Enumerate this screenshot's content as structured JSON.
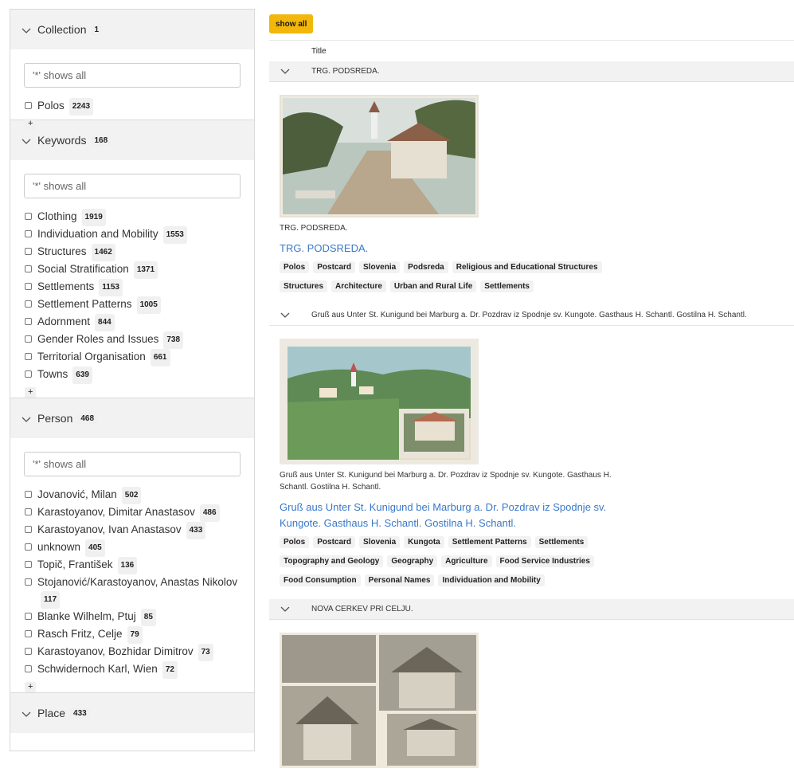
{
  "sidebar": {
    "facets": [
      {
        "title": "Collection",
        "count": "1",
        "placeholder": "'*' shows all",
        "options": [
          {
            "label": "Polos",
            "count": "2243"
          }
        ],
        "more": "+"
      },
      {
        "title": "Keywords",
        "count": "168",
        "placeholder": "'*' shows all",
        "options": [
          {
            "label": "Clothing",
            "count": "1919"
          },
          {
            "label": "Individuation and Mobility",
            "count": "1553"
          },
          {
            "label": "Structures",
            "count": "1462"
          },
          {
            "label": "Social Stratification",
            "count": "1371"
          },
          {
            "label": "Settlements",
            "count": "1153"
          },
          {
            "label": "Settlement Patterns",
            "count": "1005"
          },
          {
            "label": "Adornment",
            "count": "844"
          },
          {
            "label": "Gender Roles and Issues",
            "count": "738"
          },
          {
            "label": "Territorial Organisation",
            "count": "661"
          },
          {
            "label": "Towns",
            "count": "639"
          }
        ],
        "more": "+"
      },
      {
        "title": "Person",
        "count": "468",
        "placeholder": "'*' shows all",
        "options": [
          {
            "label": "Jovanović, Milan",
            "count": "502"
          },
          {
            "label": "Karastoyanov, Dimitar Anastasov",
            "count": "486"
          },
          {
            "label": "Karastoyanov, Ivan Anastasov",
            "count": "433"
          },
          {
            "label": "unknown",
            "count": "405"
          },
          {
            "label": "Topič, František",
            "count": "136"
          },
          {
            "label": "Stojanović/Karastoyanov, Anastas Nikolov",
            "count": "117"
          },
          {
            "label": "Blanke Wilhelm, Ptuj",
            "count": "85"
          },
          {
            "label": "Rasch Fritz, Celje",
            "count": "79"
          },
          {
            "label": "Karastoyanov, Bozhidar Dimitrov",
            "count": "73"
          },
          {
            "label": "Schwidernoch Karl, Wien",
            "count": "72"
          }
        ],
        "more": "+"
      },
      {
        "title": "Place",
        "count": "433"
      }
    ]
  },
  "main": {
    "show_all_label": "show all",
    "column_title": "Title",
    "results": [
      {
        "header": "TRG. PODSREDA.",
        "caption": "TRG. PODSREDA.",
        "link": "TRG. PODSREDA.",
        "tags": [
          "Polos",
          "Postcard",
          "Slovenia",
          "Podsreda",
          "Religious and Educational Structures",
          "Structures",
          "Architecture",
          "Urban and Rural Life",
          "Settlements"
        ]
      },
      {
        "header": "Gruß aus Unter St. Kunigund bei Marburg a. Dr. Pozdrav iz Spodnje sv. Kungote. Gasthaus H. Schantl. Gostilna H. Schantl.",
        "caption": "Gruß aus Unter St. Kunigund bei Marburg a. Dr. Pozdrav iz Spodnje sv. Kungote. Gasthaus H. Schantl. Gostilna H. Schantl.",
        "link": "Gruß aus Unter St. Kunigund bei Marburg a. Dr. Pozdrav iz Spodnje sv. Kungote. Gasthaus H. Schantl. Gostilna H. Schantl.",
        "tags": [
          "Polos",
          "Postcard",
          "Slovenia",
          "Kungota",
          "Settlement Patterns",
          "Settlements",
          "Topography and Geology",
          "Geography",
          "Agriculture",
          "Food Service Industries",
          "Food Consumption",
          "Personal Names",
          "Individuation and Mobility"
        ]
      },
      {
        "header": "NOVA CERKEV PRI CELJU."
      }
    ]
  }
}
